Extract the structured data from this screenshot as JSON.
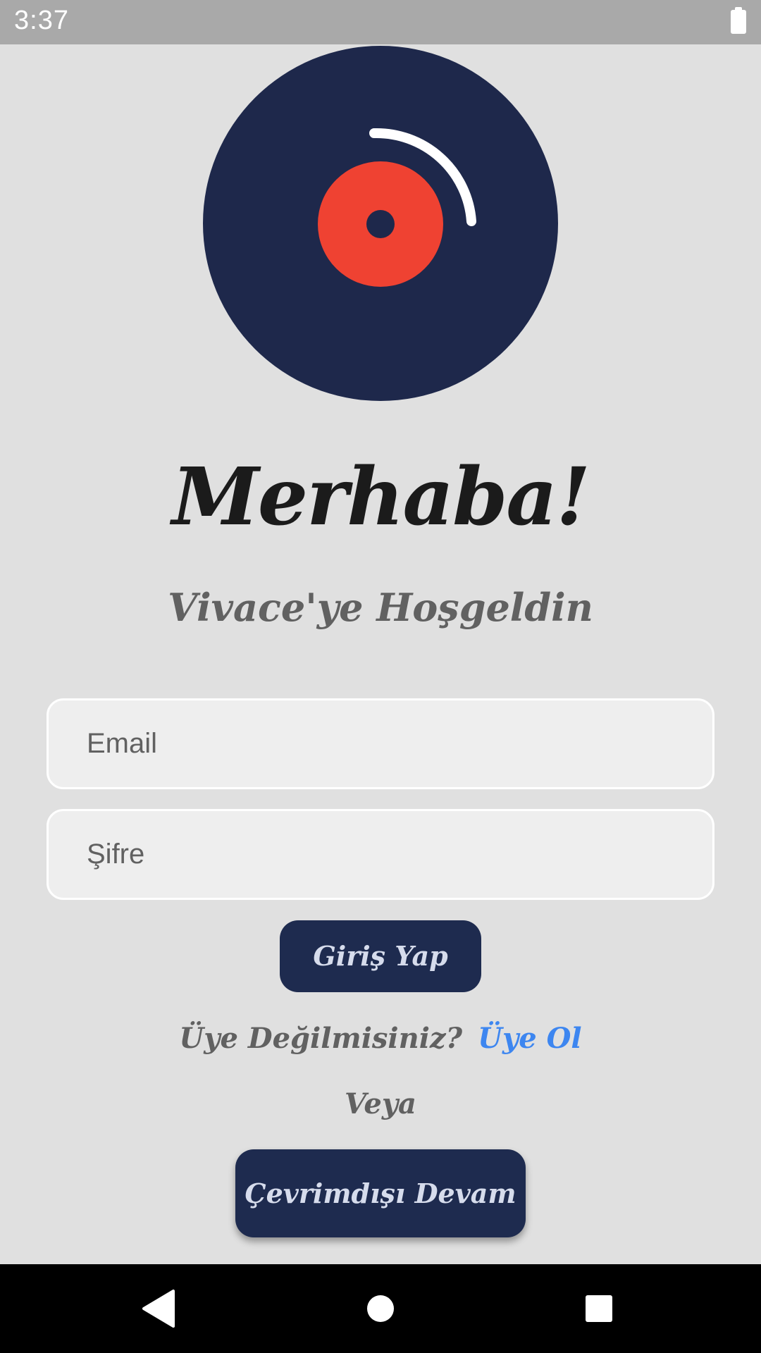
{
  "status_bar": {
    "time": "3:37",
    "battery_icon": "battery-full-icon"
  },
  "logo": {
    "icon": "vinyl-record-icon",
    "colors": {
      "disc": "#1e284b",
      "label": "#ef4232",
      "highlight": "#ffffff"
    }
  },
  "header": {
    "title": "Merhaba!",
    "subtitle": "Vivace'ye Hoşgeldin"
  },
  "form": {
    "email_placeholder": "Email",
    "password_placeholder": "Şifre",
    "login_label": "Giriş Yap"
  },
  "signup": {
    "prompt": "Üye Değilmisiniz?",
    "link_label": "Üye Ol"
  },
  "or_label": "Veya",
  "offline_label": "Çevrimdışı Devam Et",
  "nav_bar": {
    "back_icon": "back-triangle-icon",
    "home_icon": "home-circle-icon",
    "recents_icon": "recents-square-icon"
  },
  "colors": {
    "background": "#e0e0e0",
    "button": "#1e2b4f",
    "link": "#3d86f0"
  }
}
